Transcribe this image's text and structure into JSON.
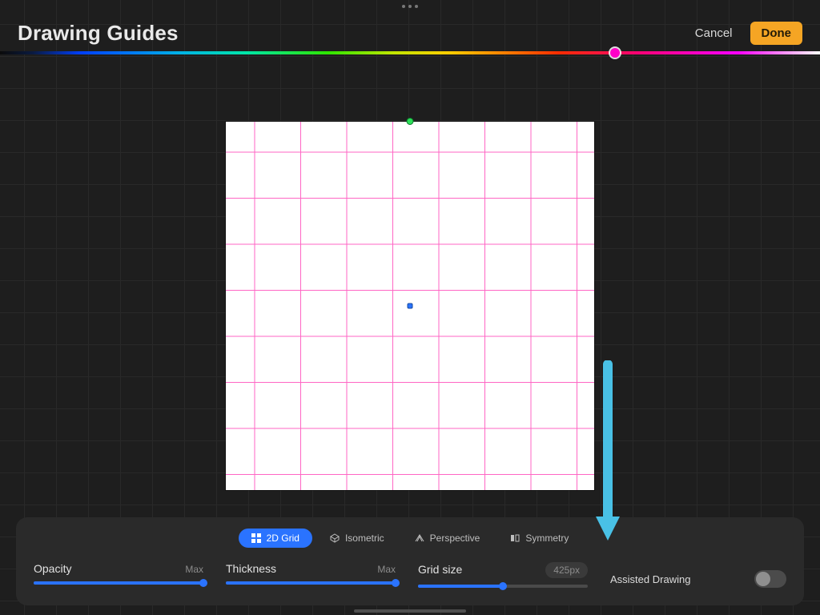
{
  "header": {
    "title": "Drawing Guides",
    "cancel_label": "Cancel",
    "done_label": "Done"
  },
  "spectrum": {
    "thumb_left_pct": 75
  },
  "guide_modes": {
    "active_index": 0,
    "items": [
      {
        "label": "2D Grid",
        "icon": "grid-2d-icon"
      },
      {
        "label": "Isometric",
        "icon": "isometric-icon"
      },
      {
        "label": "Perspective",
        "icon": "perspective-icon"
      },
      {
        "label": "Symmetry",
        "icon": "symmetry-icon"
      }
    ]
  },
  "sliders": {
    "opacity": {
      "label": "Opacity",
      "value_label": "Max",
      "fill_pct": 100
    },
    "thickness": {
      "label": "Thickness",
      "value_label": "Max",
      "fill_pct": 100
    },
    "grid_size": {
      "label": "Grid size",
      "value_label": "425px",
      "fill_pct": 50
    }
  },
  "assisted_drawing": {
    "label": "Assisted Drawing",
    "enabled": false
  }
}
